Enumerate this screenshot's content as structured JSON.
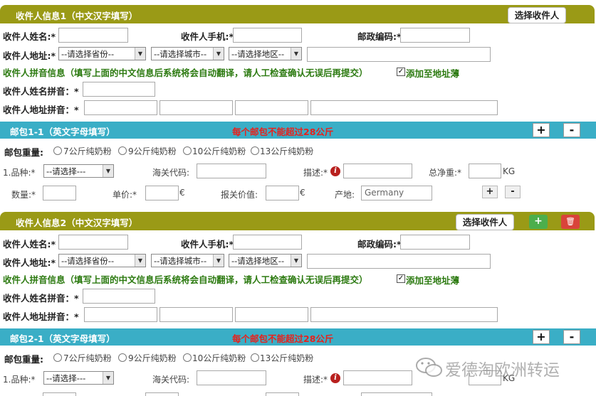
{
  "recipient_section_1": {
    "title": "收件人信息1（中文汉字填写）",
    "select_button": "选择收件人",
    "name_label": "收件人姓名:*",
    "phone_label": "收件人手机:*",
    "zip_label": "邮政编码:*",
    "address_label": "收件人地址:*",
    "province_select": "--请选择省份--",
    "city_select": "--请选择城市--",
    "district_select": "--请选择地区--",
    "pinyin_notice": "收件人拼音信息（填写上面的中文信息后系统将会自动翻译，请人工检查确认无误后再提交）",
    "add_to_addressbook": "添加至地址薄",
    "name_pinyin_label": "收件人姓名拼音：*",
    "address_pinyin_label": "收件人地址拼音：*"
  },
  "package_section_1": {
    "title": "邮包1-1（英文字母填写）",
    "warning": "每个邮包不能超过28公斤",
    "weight_label": "邮包重量:",
    "weight_options": [
      "7公斤纯奶粉",
      "9公斤纯奶粉",
      "10公斤纯奶粉",
      "13公斤纯奶粉"
    ],
    "item_label": "1.品种:*",
    "item_select": "--请选择---",
    "customs_code_label": "海关代码:",
    "description_label": "描述:*",
    "net_weight_label": "总净重:*",
    "net_weight_unit": "KG",
    "quantity_label": "数量:*",
    "unit_price_label": "单价:*",
    "unit_price_currency": "€",
    "declared_value_label": "报关价值:",
    "declared_value_currency": "€",
    "origin_label": "产地:",
    "origin_value": "Germany"
  },
  "recipient_section_2": {
    "title": "收件人信息2（中文汉字填写）",
    "select_button": "选择收件人",
    "name_label": "收件人姓名:*",
    "phone_label": "收件人手机:*",
    "zip_label": "邮政编码:*",
    "address_label": "收件人地址:*",
    "province_select": "--请选择省份--",
    "city_select": "--请选择城市--",
    "district_select": "--请选择地区--",
    "pinyin_notice": "收件人拼音信息（填写上面的中文信息后系统将会自动翻译，请人工检查确认无误后再提交）",
    "add_to_addressbook": "添加至地址薄",
    "name_pinyin_label": "收件人姓名拼音：*",
    "address_pinyin_label": "收件人地址拼音：*"
  },
  "package_section_2": {
    "title": "邮包2-1（英文字母填写）",
    "warning": "每个邮包不能超过28公斤",
    "weight_label": "邮包重量:",
    "weight_options": [
      "7公斤纯奶粉",
      "9公斤纯奶粉",
      "10公斤纯奶粉",
      "13公斤纯奶粉"
    ],
    "item_label": "1.品种:*",
    "item_select": "--请选择---",
    "customs_code_label": "海关代码:",
    "description_label": "描述:*",
    "net_weight_unit": "KG"
  },
  "controls": {
    "plus": "+",
    "minus": "-",
    "delete": "🗑"
  },
  "watermark": {
    "main": "爱德淘欧洲转运"
  },
  "colors": {
    "olive_header": "#9a9a16",
    "teal_header": "#3aaec6",
    "warning_red": "#e8211c",
    "notice_green": "#2c7a10"
  },
  "icons": {
    "info": "info-icon",
    "wechat": "wechat-icon",
    "trash": "trash-icon"
  }
}
